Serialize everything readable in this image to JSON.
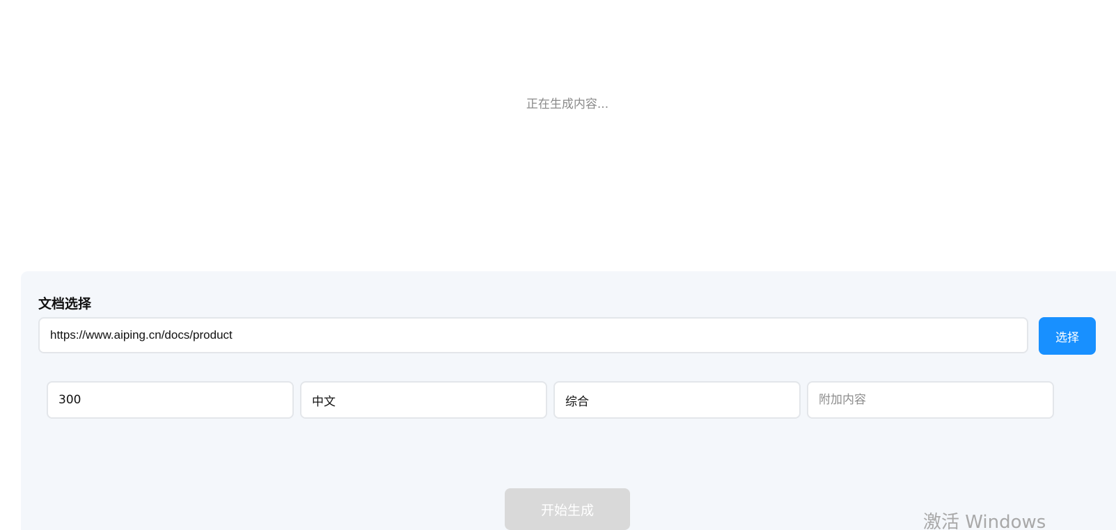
{
  "status": {
    "loading_text": "正在生成内容..."
  },
  "document_panel": {
    "title": "文档选择",
    "url_value": "https://www.aiping.cn/docs/product",
    "select_label": "选择"
  },
  "params": {
    "word_count_value": "300",
    "language_value": "中文",
    "style_value": "综合",
    "extra_placeholder": "附加内容"
  },
  "actions": {
    "start_label": "开始生成"
  },
  "watermark": {
    "text": "激活 Windows"
  },
  "colors": {
    "accent": "#1890ff",
    "panel_bg": "#f4f7fb",
    "disabled_button": "#d9d9d9"
  }
}
